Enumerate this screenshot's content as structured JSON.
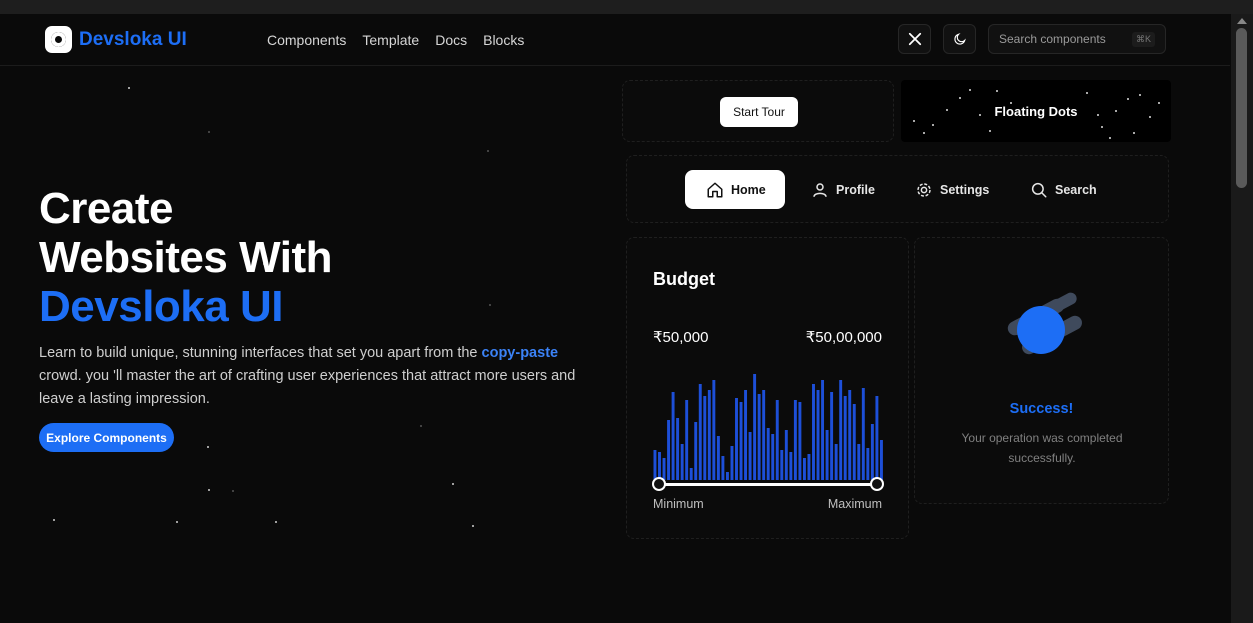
{
  "brand": {
    "name": "Devsloka UI"
  },
  "nav": [
    "Components",
    "Template",
    "Docs",
    "Blocks"
  ],
  "header": {
    "social_icon": "x-twitter-icon",
    "theme_icon": "moon-icon",
    "search_placeholder": "Search components",
    "search_shortcut": "⌘K"
  },
  "hero": {
    "title_line1": "Create",
    "title_line2": "Websites With",
    "title_accent": "Devsloka UI",
    "desc_part1": "Learn to build unique, stunning interfaces that set you apart from the ",
    "desc_highlight": "copy-paste",
    "desc_part2": " crowd. you 'll master the art of crafting user experiences that attract more users and leave a lasting impression.",
    "cta_label": "Explore Components"
  },
  "showcase": {
    "tour_button": "Start Tour",
    "floating_dots_label": "Floating Dots",
    "tabs": [
      {
        "label": "Home",
        "icon": "home-icon",
        "active": true
      },
      {
        "label": "Profile",
        "icon": "user-icon",
        "active": false
      },
      {
        "label": "Settings",
        "icon": "gear-icon",
        "active": false
      },
      {
        "label": "Search",
        "icon": "search-icon",
        "active": false
      }
    ],
    "budget": {
      "title": "Budget",
      "min_value": "₹50,000",
      "max_value": "₹50,00,000",
      "min_label": "Minimum",
      "max_label": "Maximum"
    },
    "success": {
      "title": "Success!",
      "message": "Your operation was completed successfully."
    }
  },
  "colors": {
    "accent": "#1d6ef5",
    "background": "#0a0a0a",
    "bar": "#1d4fd8"
  }
}
